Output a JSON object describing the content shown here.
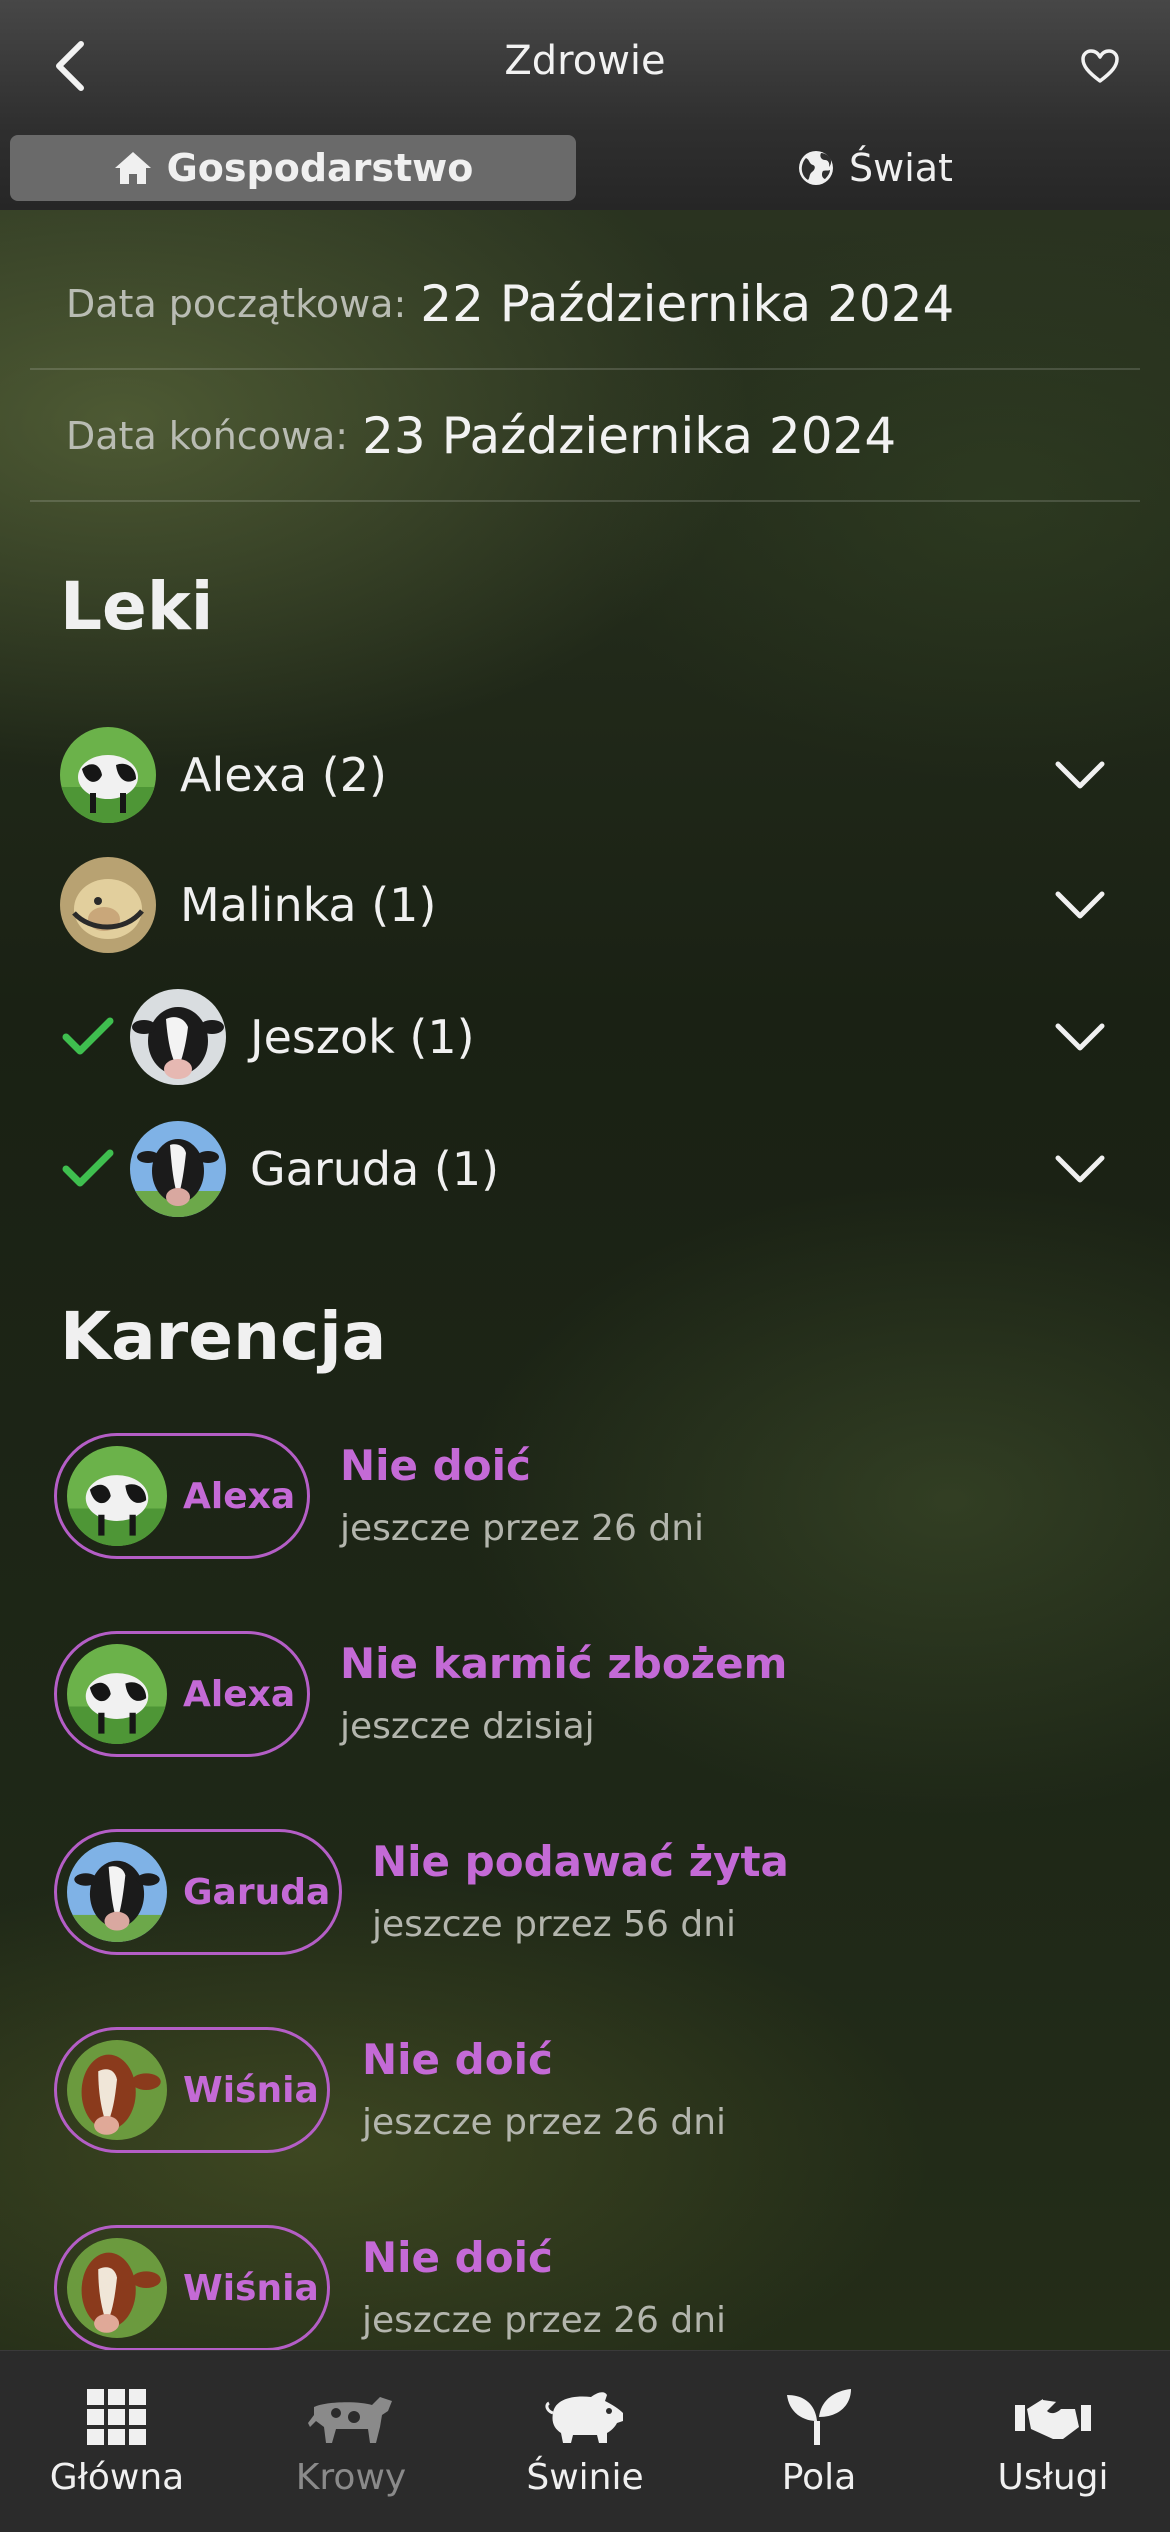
{
  "header": {
    "title": "Zdrowie",
    "back_icon": "chevron-left-icon",
    "favorite_icon": "heart-outline-icon"
  },
  "segments": [
    {
      "label": "Gospodarstwo",
      "icon": "home-icon",
      "active": true
    },
    {
      "label": "Świat",
      "icon": "globe-icon",
      "active": false
    }
  ],
  "dates": {
    "start_label": "Data początkowa:",
    "start_value": "22 Października 2024",
    "end_label": "Data końcowa:",
    "end_value": "23 Października 2024"
  },
  "medications": {
    "title": "Leki",
    "items": [
      {
        "name": "Alexa (2)",
        "checked": false
      },
      {
        "name": "Malinka (1)",
        "checked": false
      },
      {
        "name": "Jeszok (1)",
        "checked": true
      },
      {
        "name": "Garuda (1)",
        "checked": true
      }
    ]
  },
  "withdrawal": {
    "title": "Karencja",
    "items": [
      {
        "animal": "Alexa",
        "rule": "Nie doić",
        "remaining": "jeszcze przez 26 dni"
      },
      {
        "animal": "Alexa",
        "rule": "Nie karmić zbożem",
        "remaining": "jeszcze dzisiaj"
      },
      {
        "animal": "Garuda",
        "rule": "Nie podawać żyta",
        "remaining": "jeszcze przez 56 dni"
      },
      {
        "animal": "Wiśnia",
        "rule": "Nie doić",
        "remaining": "jeszcze przez 26 dni"
      },
      {
        "animal": "Wiśnia",
        "rule": "Nie doić",
        "remaining": "jeszcze przez 26 dni"
      }
    ]
  },
  "tabbar": [
    {
      "label": "Główna",
      "icon": "grid-icon"
    },
    {
      "label": "Krowy",
      "icon": "cow-icon"
    },
    {
      "label": "Świnie",
      "icon": "pig-icon"
    },
    {
      "label": "Pola",
      "icon": "sprout-icon"
    },
    {
      "label": "Usługi",
      "icon": "handshake-icon"
    }
  ],
  "colors": {
    "accent": "#c46ad6",
    "check": "#3fbf4f",
    "tabbar": "#2b2b2b"
  }
}
